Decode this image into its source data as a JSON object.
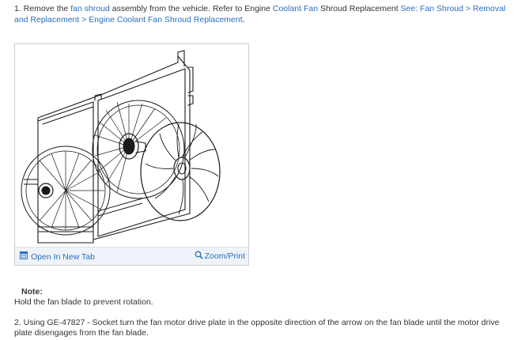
{
  "step1": {
    "prefix": "1. Remove the ",
    "link_fan_shroud": "fan shroud",
    "mid": " assembly from the vehicle. Refer to Engine ",
    "link_coolant_fan": "Coolant Fan",
    "mid2": " Shroud Replacement ",
    "link_see": "See: Fan Shroud > Removal and Replacement > Engine Coolant Fan Shroud Replacement",
    "suffix": "."
  },
  "figure": {
    "image_icon": "fan-shroud-illustration",
    "open_tab_label": "Open In New Tab",
    "open_tab_icon": "open-in-new-tab-icon",
    "zoom_label": "Zoom/Print",
    "zoom_icon": "magnifier-icon"
  },
  "note": {
    "title": "Note:",
    "text": "Hold the fan blade to prevent rotation."
  },
  "step2": {
    "text": "2. Using GE-47827 - Socket turn the fan motor drive plate in the opposite direction of the arrow on the fan blade until the motor drive plate disengages from the fan blade."
  },
  "colors": {
    "link": "#2a6ebb",
    "text": "#333333",
    "toolbar_bg": "#eef3f9",
    "border": "#c9ced4"
  }
}
